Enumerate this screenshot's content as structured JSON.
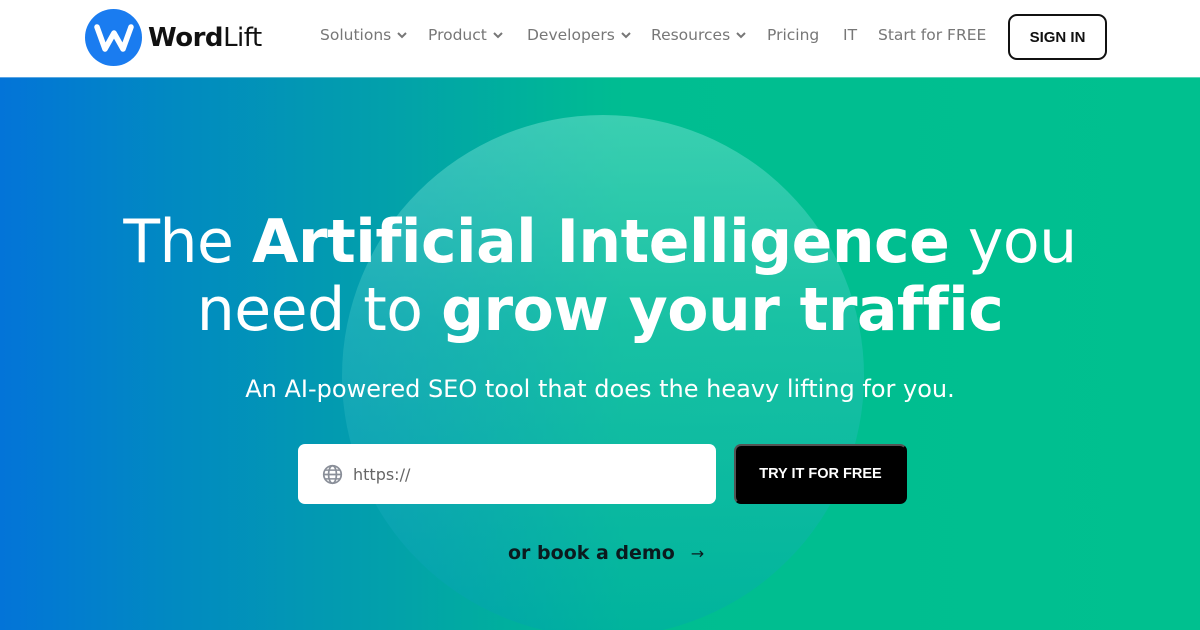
{
  "brand": {
    "name_bold": "Word",
    "name_light": "Lift",
    "logo_letter": "W",
    "color": "#1a7cf0"
  },
  "nav": {
    "items": [
      {
        "label": "Solutions",
        "has_dropdown": true
      },
      {
        "label": "Product",
        "has_dropdown": true
      },
      {
        "label": "Developers",
        "has_dropdown": true
      },
      {
        "label": "Resources",
        "has_dropdown": true
      },
      {
        "label": "Pricing",
        "has_dropdown": false
      },
      {
        "label": "IT",
        "has_dropdown": false
      },
      {
        "label": "Start for FREE",
        "has_dropdown": false
      }
    ],
    "signin_label": "SIGN IN"
  },
  "hero": {
    "headline": {
      "line1": [
        {
          "text": "The ",
          "weight": "light"
        },
        {
          "text": "Artificial Intelligence",
          "weight": "bold"
        },
        {
          "text": " you",
          "weight": "light"
        }
      ],
      "line2": [
        {
          "text": "need to ",
          "weight": "light"
        },
        {
          "text": "grow your traffic",
          "weight": "bold"
        }
      ]
    },
    "subtitle": "An AI-powered SEO tool that does the heavy lifting for you.",
    "url_input": {
      "icon": "globe-icon",
      "placeholder": "https://",
      "value": ""
    },
    "cta_label": "TRY IT FOR FREE",
    "demo_label": "or book a demo",
    "demo_arrow": "→",
    "gradient": {
      "start": "#0374d8",
      "end": "#00c08f"
    }
  }
}
